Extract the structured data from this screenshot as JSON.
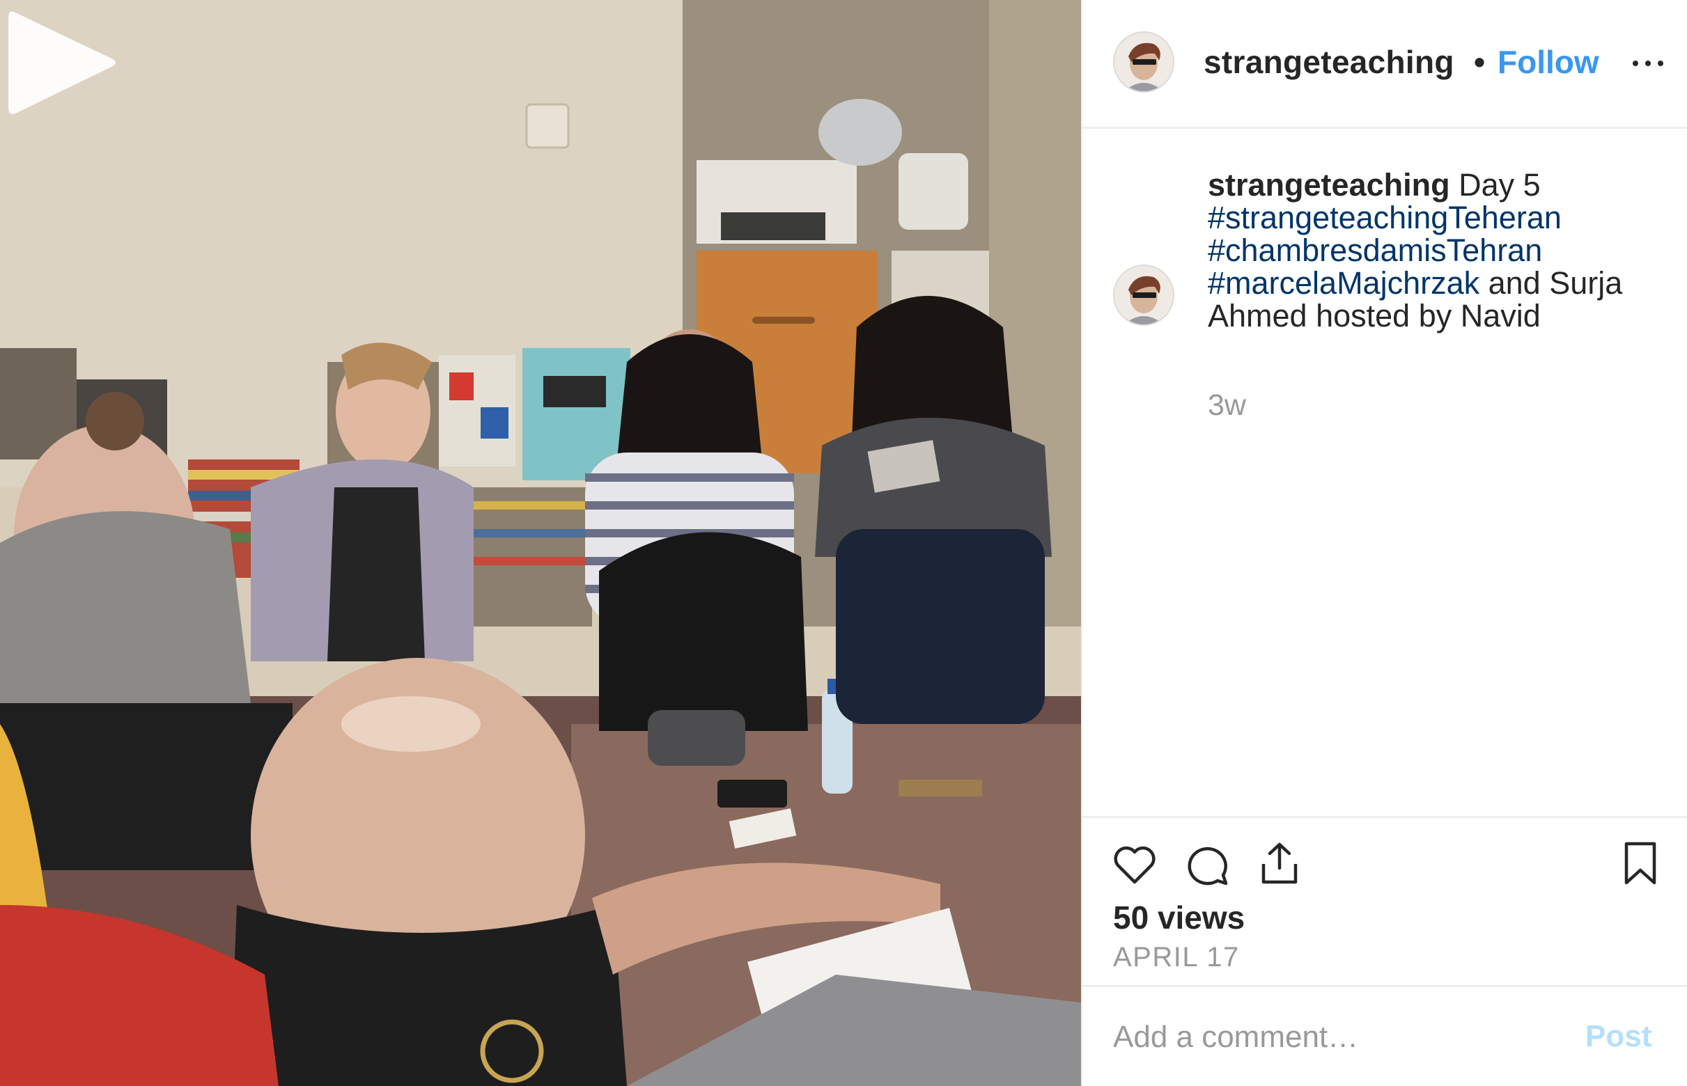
{
  "post": {
    "username": "strangeteaching",
    "separator": "•",
    "follow_label": "Follow",
    "more_icon": "more-horizontal-icon",
    "media_type": "video",
    "play_icon": "play-icon"
  },
  "caption": {
    "username": "strangeteaching",
    "text_intro": " Day 5 ",
    "hashtags": [
      "#strangeteachingTeheran",
      "#chambresdamisTehran",
      "#marcelaMajchrzak"
    ],
    "text_outro": " and Surja Ahmed hosted by Navid",
    "time_ago": "3w"
  },
  "actions": {
    "icons": [
      "heart-icon",
      "comment-icon",
      "share-icon",
      "bookmark-icon"
    ],
    "views": "50 views",
    "date": "APRIL 17"
  },
  "comment": {
    "placeholder": "Add a comment…",
    "post_label": "Post"
  },
  "colors": {
    "link_blue": "#3897f0",
    "hashtag_blue": "#003569",
    "post_disabled": "#b2dffc",
    "text": "#262626",
    "muted": "#999999",
    "divider": "#efefef"
  }
}
